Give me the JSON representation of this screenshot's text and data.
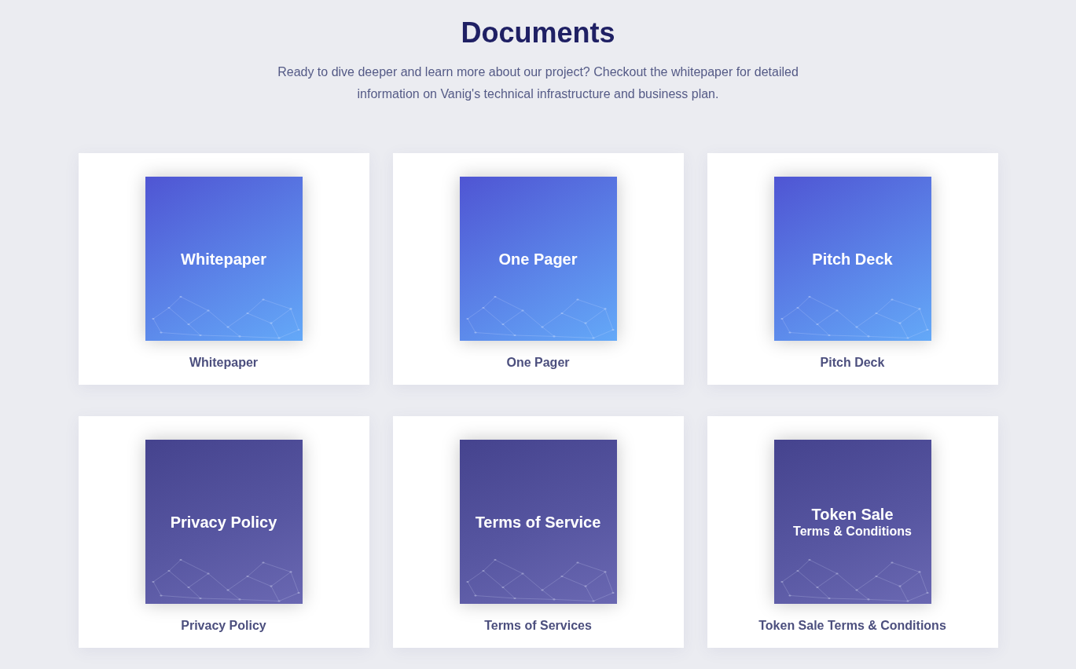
{
  "heading": "Documents",
  "intro": "Ready to dive deeper and learn more about our project? Checkout the whitepaper for detailed information on Vanig's technical infrastructure and business plan.",
  "documents": [
    {
      "kind": "blue",
      "cover_title": "Whitepaper",
      "label": "Whitepaper"
    },
    {
      "kind": "blue",
      "cover_title": "One Pager",
      "label": "One Pager"
    },
    {
      "kind": "blue",
      "cover_title": "Pitch Deck",
      "label": "Pitch Deck"
    },
    {
      "kind": "purple",
      "cover_title": "Privacy Policy",
      "label": "Privacy Policy"
    },
    {
      "kind": "purple",
      "cover_title": "Terms of Service",
      "label": "Terms of Services"
    },
    {
      "kind": "purple",
      "cover_title": "Token Sale",
      "cover_subtitle": "Terms & Conditions",
      "label": "Token Sale Terms & Conditions"
    }
  ]
}
